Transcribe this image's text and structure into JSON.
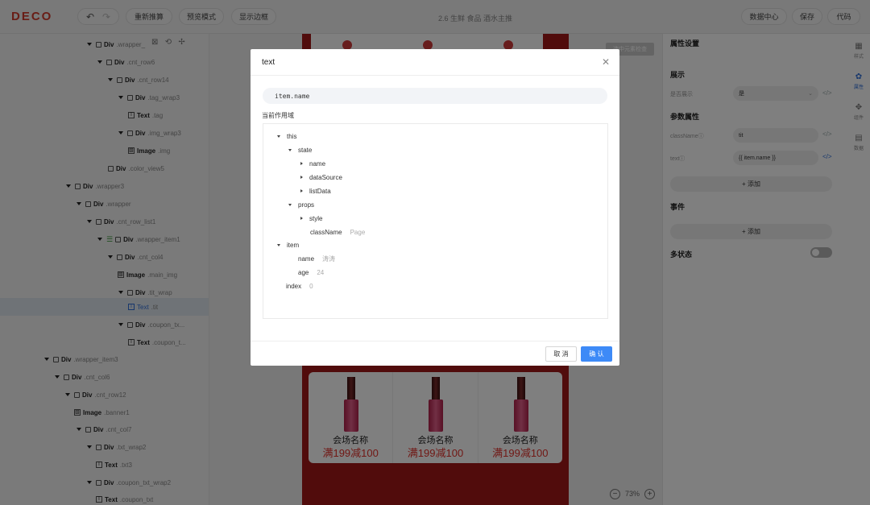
{
  "app": {
    "logo": "DECO",
    "project_title": "2.6 生鲜 食品 酒水主推"
  },
  "toolbar": {
    "undo_icon": "↶",
    "redo_icon": "↷",
    "recommend_label": "重新推算",
    "preview_label": "预览模式",
    "border_label": "显示边框",
    "data_center_label": "数据中心",
    "save_label": "保存",
    "code_label": "代码"
  },
  "tree": {
    "nodes": [
      {
        "tag": "Div",
        "cls": ".wrapper_"
      },
      {
        "tag": "Div",
        "cls": ".cnt_row6"
      },
      {
        "tag": "Div",
        "cls": ".cnt_row14"
      },
      {
        "tag": "Div",
        "cls": ".tag_wrap3"
      },
      {
        "tag": "Text",
        "cls": ".tag"
      },
      {
        "tag": "Div",
        "cls": ".img_wrap3"
      },
      {
        "tag": "Image",
        "cls": ".img"
      },
      {
        "tag": "Div",
        "cls": ".color_view5"
      },
      {
        "tag": "Div",
        "cls": ".wrapper3"
      },
      {
        "tag": "Div",
        "cls": ".wrapper"
      },
      {
        "tag": "Div",
        "cls": ".cnt_row_list1"
      },
      {
        "tag": "Div",
        "cls": ".wrapper_item1"
      },
      {
        "tag": "Div",
        "cls": ".cnt_col4"
      },
      {
        "tag": "Image",
        "cls": ".main_img"
      },
      {
        "tag": "Div",
        "cls": ".tit_wrap"
      },
      {
        "tag": "Text",
        "cls": ".tit"
      },
      {
        "tag": "Div",
        "cls": ".coupon_tx..."
      },
      {
        "tag": "Text",
        "cls": ".coupon_t..."
      },
      {
        "tag": "Div",
        "cls": ".wrapper_item3"
      },
      {
        "tag": "Div",
        "cls": ".cnt_col6"
      },
      {
        "tag": "Div",
        "cls": ".cnt_row12"
      },
      {
        "tag": "Image",
        "cls": ".banner1"
      },
      {
        "tag": "Div",
        "cls": ".cnt_col7"
      },
      {
        "tag": "Div",
        "cls": ".txt_wrap2"
      },
      {
        "tag": "Text",
        "cls": ".txt3"
      },
      {
        "tag": "Div",
        "cls": ".coupon_txt_wrap2"
      },
      {
        "tag": "Text",
        "cls": ".coupon_txt"
      }
    ]
  },
  "canvas": {
    "badge_label": "选中元素检查",
    "cards": [
      {
        "name": "会场名称",
        "coupon": "满199减100"
      },
      {
        "name": "会场名称",
        "coupon": "满199减100"
      },
      {
        "name": "会场名称",
        "coupon": "满199减100"
      }
    ],
    "zoom_minus": "−",
    "zoom_plus": "+",
    "zoom_value": "73%"
  },
  "right_panel": {
    "title": "属性设置",
    "display_section": "展示",
    "display_label": "是否展示",
    "display_value": "是",
    "params_section": "参数属性",
    "classname_label": "className",
    "classname_value": "tit",
    "text_label": "text",
    "text_value": "{{ item.name }}",
    "add_label": "+ 添加",
    "events_section": "事件",
    "events_add_label": "+ 添加",
    "multi_state_label": "多状态",
    "tabs": [
      {
        "icon": "▦",
        "label": "样式"
      },
      {
        "icon": "✿",
        "label": "属性"
      },
      {
        "icon": "✥",
        "label": "组件"
      },
      {
        "icon": "▤",
        "label": "数据"
      }
    ],
    "colors": {
      "accent": "#2f6fd9",
      "primary_button": "#3d8af7",
      "brand": "#d23a2c"
    }
  },
  "modal": {
    "title": "text",
    "close_icon": "✕",
    "expression": "item.name",
    "scope_label": "当前作用域",
    "scope": {
      "this": "this",
      "state": "state",
      "name": "name",
      "dataSource": "dataSource",
      "listData": "listData",
      "props": "props",
      "style": "style",
      "className": "className",
      "className_value": "Page",
      "item": "item",
      "item_name": "name",
      "item_name_value": "涛涛",
      "age": "age",
      "age_value": "24",
      "index": "index",
      "index_value": "0"
    },
    "cancel_label": "取 消",
    "ok_label": "确 认"
  }
}
